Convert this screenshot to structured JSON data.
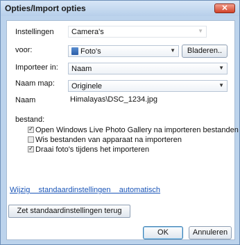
{
  "window": {
    "title": "Opties/Import opties",
    "close_glyph": "✕"
  },
  "form": {
    "settings_label": "Instellingen",
    "settings_value": "Camera's",
    "for_label": "voor:",
    "for_value": "Foto's",
    "browse_label": "Bladeren..",
    "import_in_label": "Importeer in:",
    "import_in_value": "Naam",
    "folder_name_label": "Naam map:",
    "folder_name_value": "Originele",
    "name_label": "Naam",
    "name_value": "Himalayas\\DSC_1234.jpg",
    "file_label": "bestand:"
  },
  "options": [
    {
      "label": "Open Windows Live Photo Gallery na importeren bestanden",
      "checked": true
    },
    {
      "label": "Wis bestanden van apparaat na importeren",
      "checked": false
    },
    {
      "label": "Draai foto's tijdens het importeren",
      "checked": true
    }
  ],
  "link": {
    "text": "Wijzig    standaardinstellingen    automatisch"
  },
  "buttons": {
    "reset_label": "Zet standaardinstellingen terug",
    "ok_label": "OK",
    "cancel_label": "Annuleren"
  }
}
